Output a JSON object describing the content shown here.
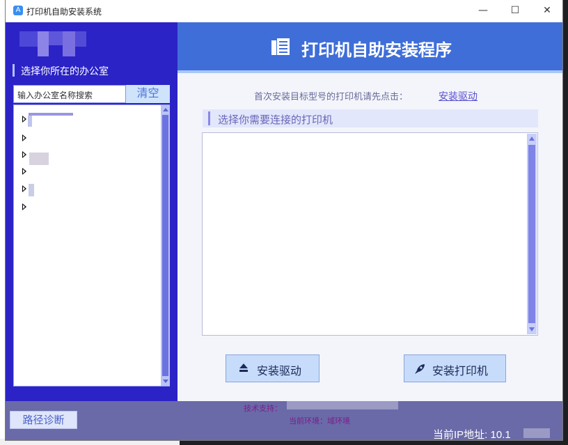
{
  "window": {
    "title": "打印机自助安装系统",
    "controls": {
      "minimize": "—",
      "maximize": "☐",
      "close": "✕"
    }
  },
  "left_panel": {
    "office_header": "选择你所在的办公室",
    "search_placeholder": "输入办公室名称搜索",
    "clear_label": "清空",
    "tree_items": [
      "",
      "",
      "",
      "",
      "",
      ""
    ]
  },
  "banner": {
    "title": "打印机自助安装程序",
    "icon": "printer-icon"
  },
  "main": {
    "hint": "首次安装目标型号的打印机请先点击：",
    "driver_link": "安装驱动",
    "printer_header": "选择你需要连接的打印机"
  },
  "buttons": {
    "install_driver": "安装驱动",
    "install_printer": "安装打印机"
  },
  "footer": {
    "diagnose": "路径诊断",
    "tech_support": "技术支持：",
    "environment": "当前环境：域环境",
    "ip": "当前IP地址: 10.1"
  },
  "colors": {
    "left_panel": "#2b23c6",
    "banner": "#3f6ed8",
    "footer": "#6a6aa8"
  }
}
